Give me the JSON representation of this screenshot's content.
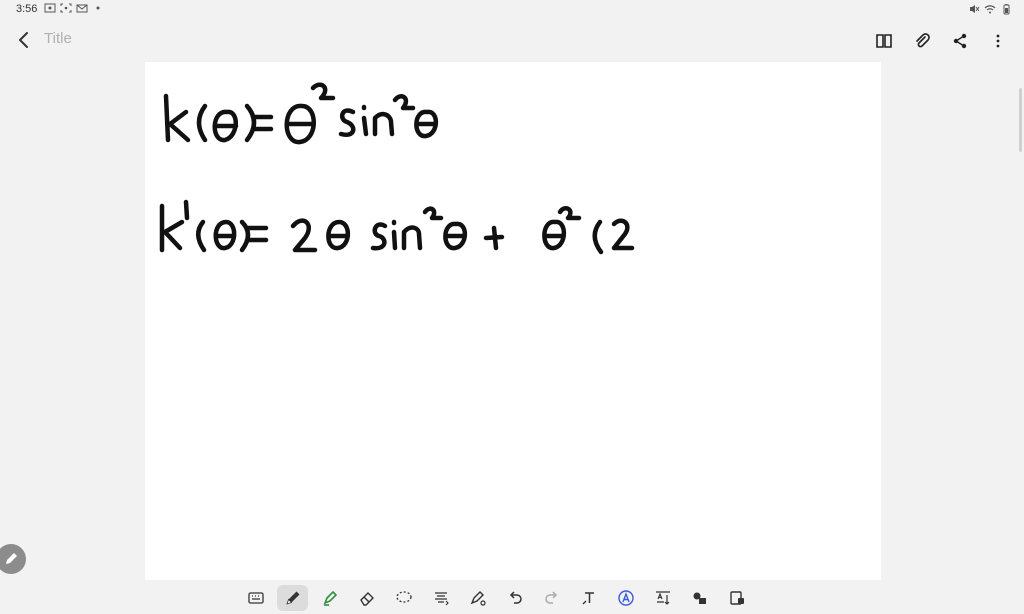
{
  "status_bar": {
    "time": "3:56"
  },
  "app_bar": {
    "title_placeholder": "Title"
  },
  "colors": {
    "ink": "#111111",
    "accent_text": "#3b5bdb",
    "highlighter": "#2f8f3f",
    "background": "#f2f2f2",
    "page": "#ffffff"
  },
  "toolbar": {
    "tools": [
      "keyboard-icon",
      "pen-icon",
      "highlighter-icon",
      "eraser-icon",
      "lasso-icon",
      "text-align-icon",
      "shape-pen-icon",
      "undo-icon",
      "redo-icon",
      "text-icon",
      "text-style-icon",
      "insert-text-icon",
      "shapes-icon",
      "lock-icon"
    ],
    "active_tool": "pen-icon"
  }
}
